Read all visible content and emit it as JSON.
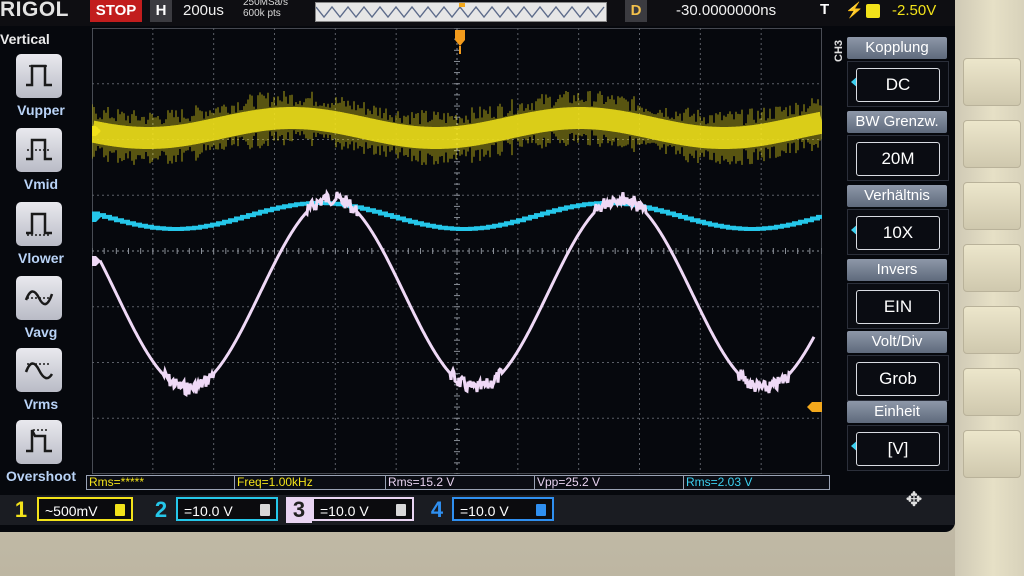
{
  "topbar": {
    "brand": "RIGOL",
    "run_state": "STOP",
    "timebase_mode": "H",
    "timebase": "200us",
    "sample_rate": "250MSa/s",
    "memory_depth": "600k pts",
    "delay_mode": "D",
    "delay": "-30.0000000ns",
    "trigger_type": "T",
    "trigger_slope": "⚡",
    "trigger_level": "-2.50V",
    "trigger_source_color": "#f2e21a"
  },
  "left_menu": {
    "title": "Vertical",
    "items": [
      {
        "label": "Vupper",
        "icon": "vupper-icon"
      },
      {
        "label": "Vmid",
        "icon": "vmid-icon"
      },
      {
        "label": "Vlower",
        "icon": "vlower-icon"
      },
      {
        "label": "Vavg",
        "icon": "vavg-icon"
      },
      {
        "label": "Vrms",
        "icon": "vrms-icon"
      },
      {
        "label": "Overshoot",
        "icon": "overshoot-icon"
      }
    ]
  },
  "right_menu": {
    "channel_tag": "CH3",
    "items": [
      {
        "title": "Kopplung",
        "value": "DC",
        "has_arrow": true
      },
      {
        "title": "BW Grenzw.",
        "value": "20M",
        "has_arrow": false
      },
      {
        "title": "Verhältnis",
        "value": "10X",
        "has_arrow": true
      },
      {
        "title": "Invers",
        "value": "EIN",
        "has_arrow": false
      },
      {
        "title": "Volt/Div",
        "value": "Grob",
        "has_arrow": false
      },
      {
        "title": "Einheit",
        "value": "[V]",
        "has_arrow": true
      }
    ]
  },
  "measurements": [
    {
      "text": "Rms=*****",
      "color": "#f2e21a"
    },
    {
      "text": "Freq=1.00kHz",
      "color": "#f2e21a"
    },
    {
      "text": "Rms=15.2 V",
      "color": "#e8d3f0"
    },
    {
      "text": "Vpp=25.2 V",
      "color": "#e8d3f0"
    },
    {
      "text": "Rms=2.03 V",
      "color": "#3dd0f0"
    }
  ],
  "channels": [
    {
      "num": "1",
      "scale": "~500mV",
      "color": "#f2e21a"
    },
    {
      "num": "2",
      "scale": "=10.0 V",
      "color": "#25c7ea"
    },
    {
      "num": "3",
      "scale": "=10.0 V",
      "color": "#e9d5f3"
    },
    {
      "num": "4",
      "scale": "=10.0 V",
      "color": "#2f8ff0"
    }
  ],
  "colors": {
    "ch1": "#f2e21a",
    "ch2": "#25c7ea",
    "ch3": "#efd9f6",
    "background": "#06080d"
  },
  "nav_icon": "navigation-icon"
}
